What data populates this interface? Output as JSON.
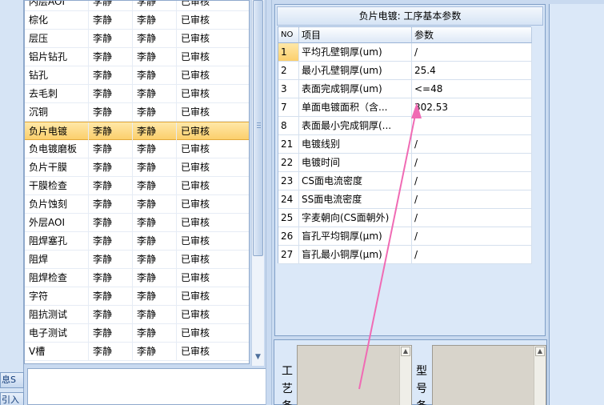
{
  "left_strip": {
    "tab1": "息S",
    "tab2": "引入"
  },
  "process_list": {
    "rows": [
      [
        "内层AOI",
        "李静",
        "李静",
        "已审核"
      ],
      [
        "棕化",
        "李静",
        "李静",
        "已审核"
      ],
      [
        "层压",
        "李静",
        "李静",
        "已审核"
      ],
      [
        "铝片钻孔",
        "李静",
        "李静",
        "已审核"
      ],
      [
        "钻孔",
        "李静",
        "李静",
        "已审核"
      ],
      [
        "去毛刺",
        "李静",
        "李静",
        "已审核"
      ],
      [
        "沉铜",
        "李静",
        "李静",
        "已审核"
      ],
      [
        "负片电镀",
        "李静",
        "李静",
        "已审核"
      ],
      [
        "负电镀磨板",
        "李静",
        "李静",
        "已审核"
      ],
      [
        "负片干膜",
        "李静",
        "李静",
        "已审核"
      ],
      [
        "干膜检查",
        "李静",
        "李静",
        "已审核"
      ],
      [
        "负片蚀刻",
        "李静",
        "李静",
        "已审核"
      ],
      [
        "外层AOI",
        "李静",
        "李静",
        "已审核"
      ],
      [
        "阻焊塞孔",
        "李静",
        "李静",
        "已审核"
      ],
      [
        "阻焊",
        "李静",
        "李静",
        "已审核"
      ],
      [
        "阻焊检查",
        "李静",
        "李静",
        "已审核"
      ],
      [
        "字符",
        "李静",
        "李静",
        "已审核"
      ],
      [
        "阻抗测试",
        "李静",
        "李静",
        "已审核"
      ],
      [
        "电子测试",
        "李静",
        "李静",
        "已审核"
      ],
      [
        "V槽",
        "李静",
        "李静",
        "已审核"
      ]
    ],
    "selected_index": 7
  },
  "params": {
    "title": "负片电镀: 工序基本参数",
    "headers": {
      "no": "NO",
      "item": "项目",
      "value": "参数"
    },
    "rows": [
      [
        "1",
        "平均孔壁铜厚(um)",
        "/"
      ],
      [
        "2",
        "最小孔壁铜厚(um)",
        "25.4"
      ],
      [
        "3",
        "表面完成铜厚(um)",
        "<=48"
      ],
      [
        "7",
        "单面电镀面积（含...",
        "302.53"
      ],
      [
        "8",
        "表面最小完成铜厚(...",
        ""
      ],
      [
        "21",
        "电镀线别",
        "/"
      ],
      [
        "22",
        "电镀时间",
        "/"
      ],
      [
        "23",
        "CS面电流密度",
        "/"
      ],
      [
        "24",
        "SS面电流密度",
        "/"
      ],
      [
        "25",
        "字麦朝向(CS面朝外)",
        "/"
      ],
      [
        "26",
        "盲孔平均铜厚(μm)",
        "/"
      ],
      [
        "27",
        "盲孔最小铜厚(μm)",
        "/"
      ]
    ],
    "selected_index": 0
  },
  "bottom": {
    "label1_chars": [
      "工",
      "艺",
      "备"
    ],
    "label2_chars": [
      "型",
      "号",
      "备"
    ]
  },
  "colors": {
    "annotation_arrow": "#f06bb4",
    "selection": "#fbcf6c"
  }
}
